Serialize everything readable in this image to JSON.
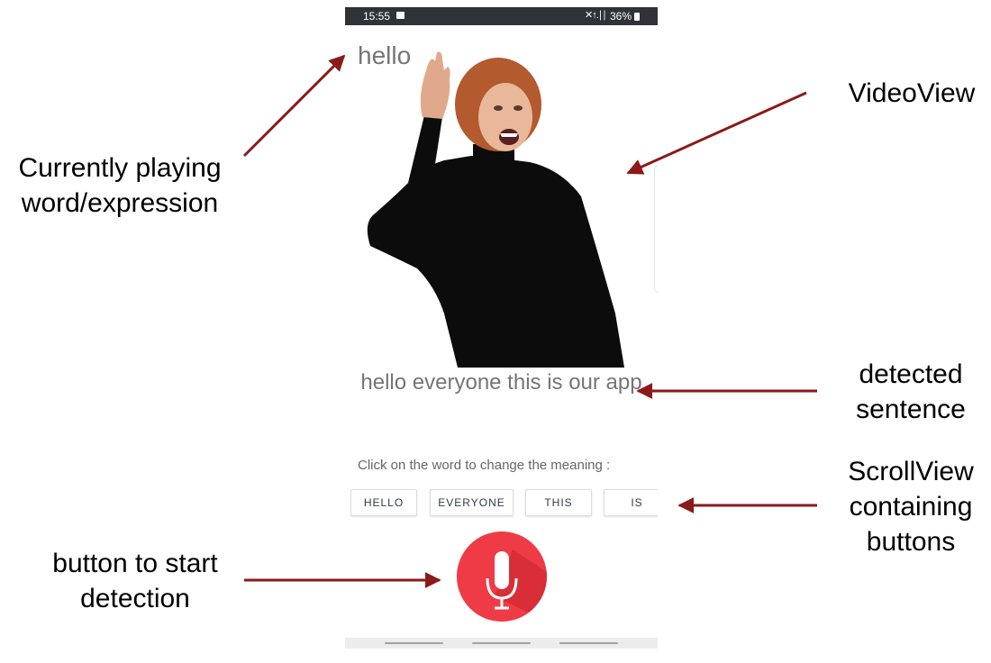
{
  "status_bar": {
    "time": "15:55",
    "signal": "✕↑.∣∣",
    "battery": "36%"
  },
  "app": {
    "current_word": "hello",
    "detected_sentence": "hello everyone this is our app",
    "hint": "Click on the word to change the meaning :",
    "word_buttons": [
      "HELLO",
      "EVERYONE",
      "THIS",
      "IS"
    ],
    "mic_icon": "microphone-icon",
    "accent_color": "#ee3b45"
  },
  "annotations": {
    "current_word": "Currently playing word/expression",
    "video_view": "VideoView",
    "detected_sentence": "detected sentence",
    "scroll_view": "ScrollView containing buttons",
    "start_button": "button to start detection",
    "arrow_color": "#8b1a1a"
  }
}
